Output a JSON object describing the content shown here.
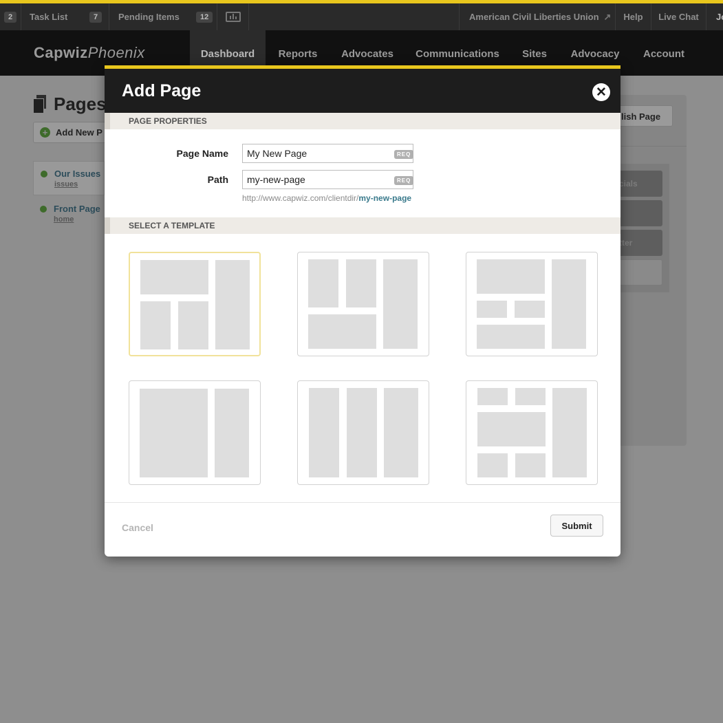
{
  "topbar": {
    "first_count": "2",
    "task_list": {
      "label": "Task List",
      "count": "7"
    },
    "pending_items": {
      "label": "Pending Items",
      "count": "12"
    },
    "org_name": "American Civil Liberties Union",
    "help": "Help",
    "live_chat": "Live Chat",
    "user_initial": "Jo"
  },
  "header": {
    "logo_main": "Capwiz",
    "logo_italic": "Phoenix",
    "nav": [
      "Dashboard",
      "Reports",
      "Advocates",
      "Communications",
      "Sites",
      "Advocacy",
      "Account"
    ],
    "active_nav": "Dashboard"
  },
  "background_page": {
    "title": "Pages",
    "add_new_label": "Add New P",
    "publish_label": "lish Page",
    "items": [
      {
        "title": "Our Issues",
        "slug": "issues"
      },
      {
        "title": "Front Page",
        "slug": "home"
      }
    ],
    "side_buttons": [
      "cials",
      "",
      "tter",
      ""
    ]
  },
  "modal": {
    "title": "Add Page",
    "section_properties": "PAGE PROPERTIES",
    "page_name": {
      "label": "Page Name",
      "value": "My New Page",
      "badge": "REQ"
    },
    "path": {
      "label": "Path",
      "value": "my-new-page",
      "badge": "REQ"
    },
    "url_prefix": "http://www.capwiz.com/clientdir/",
    "url_slug": "my-new-page",
    "section_template": "SELECT A TEMPLATE",
    "selected_template": 1,
    "cancel": "Cancel",
    "submit": "Submit"
  },
  "colors": {
    "accent": "#e8c61d",
    "selected_template_border": "#f1e29a",
    "link": "#3a7a8c"
  }
}
